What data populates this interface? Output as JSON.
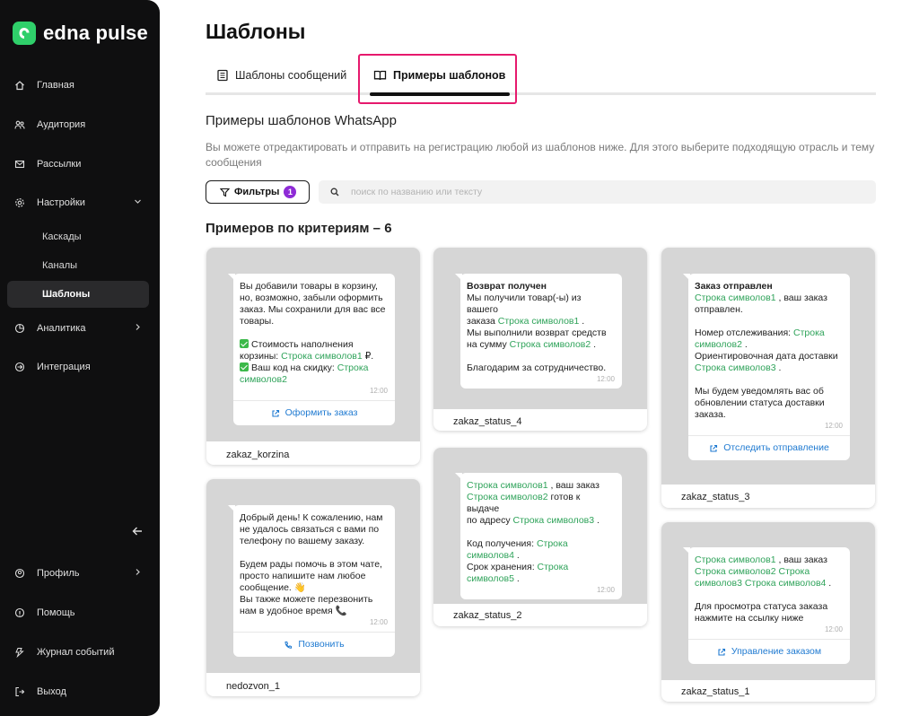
{
  "logo": {
    "text": "edna pulse",
    "color": "#2fcf6a"
  },
  "sidebar": {
    "nav": [
      {
        "label": "Главная",
        "icon": "home-icon"
      },
      {
        "label": "Аудитория",
        "icon": "audience-icon"
      },
      {
        "label": "Рассылки",
        "icon": "mail-icon"
      },
      {
        "label": "Настройки",
        "icon": "gear-icon"
      }
    ],
    "settings_sub": [
      {
        "label": "Каскады"
      },
      {
        "label": "Каналы"
      },
      {
        "label": "Шаблоны"
      }
    ],
    "nav2": [
      {
        "label": "Аналитика",
        "icon": "chart-icon"
      },
      {
        "label": "Интеграция",
        "icon": "integration-icon"
      }
    ],
    "bottom": [
      {
        "label": "Профиль",
        "icon": "profile-icon"
      },
      {
        "label": "Помощь",
        "icon": "help-icon"
      },
      {
        "label": "Журнал событий",
        "icon": "log-icon"
      },
      {
        "label": "Выход",
        "icon": "logout-icon"
      }
    ]
  },
  "page": {
    "title": "Шаблоны",
    "tabs": [
      {
        "label": "Шаблоны сообщений"
      },
      {
        "label": "Примеры шаблонов"
      }
    ],
    "section_title": "Примеры шаблонов WhatsApp",
    "section_desc": "Вы можете отредактировать и отправить на регистрацию любой из шаблонов ниже. Для этого выберите подходящую отрасль и тему сообщения",
    "filters_label": "Фильтры",
    "filters_count": "1",
    "search_placeholder": "поиск по названию или тексту",
    "count_title": "Примеров по критериям – 6",
    "accent_color": "#e6196d"
  },
  "cards": {
    "zakaz_korzina": {
      "l1": "Вы добавили товары в корзину,",
      "l2": "но, возможно, забыли оформить",
      "l3": "заказ. Мы сохранили для вас все",
      "l4": "товары.",
      "l5": "Стоимость наполнения",
      "l6a": "корзины: ",
      "l6v": "Строка символов1",
      "l6b": " ₽.",
      "l7a": "Ваш код на скидку: ",
      "l7v": "Строка",
      "l8v": "символов2",
      "time": "12:00",
      "button": "Оформить заказ",
      "caption": "zakaz_korzina"
    },
    "zakaz_status_4": {
      "title": "Возврат получен",
      "l1": "Мы получили товар(-ы) из вашего",
      "l2a": "заказа ",
      "l2v": "Строка символов1",
      "l2b": " .",
      "l3": "Мы выполнили возврат средств",
      "l4a": "на сумму ",
      "l4v": "Строка символов2",
      "l4b": " .",
      "l5": "Благодарим за сотрудничество.",
      "time": "12:00",
      "caption": "zakaz_status_4"
    },
    "zakaz_status_3": {
      "title": "Заказ отправлен",
      "l1v": "Строка символов1",
      "l1b": " , ваш заказ",
      "l2": "отправлен.",
      "l3a": "Номер отслеживания: ",
      "l3v": "Строка",
      "l4v": "символов2",
      "l4b": " .",
      "l5": "Ориентировочная дата доставки",
      "l6v": "Строка символов3",
      "l6b": " .",
      "l7": "Мы будем уведомлять вас об",
      "l8": "обновлении статуса доставки",
      "l9": "заказа.",
      "time": "12:00",
      "button": "Отследить отправление",
      "caption": "zakaz_status_3"
    },
    "nedozvon_1": {
      "l1": "Добрый день! К сожалению, нам",
      "l2": "не удалось связаться с вами по",
      "l3": "телефону по вашему заказу.",
      "l4": "Будем рады помочь в этом чате,",
      "l5": "просто напишите нам любое",
      "l6": "сообщение. 👋",
      "l7": "Вы также можете перезвонить",
      "l8": "нам в удобное время 📞",
      "time": "12:00",
      "button": "Позвонить",
      "caption": "nedozvon_1"
    },
    "zakaz_status_2": {
      "l1v": "Строка символов1",
      "l1b": " , ваш заказ",
      "l2v": "Строка символов2",
      "l2b": "  готов к выдаче",
      "l3a": "по адресу ",
      "l3v": "Строка символов3",
      "l3b": " .",
      "l4a": "Код получения: ",
      "l4v": "Строка",
      "l5v": "символов4",
      "l5b": " .",
      "l6a": "Срок хранения: ",
      "l6v": "Строка",
      "l7v": "символов5",
      "l7b": " .",
      "time": "12:00",
      "caption": "zakaz_status_2"
    },
    "zakaz_status_1": {
      "l1v": "Строка символов1",
      "l1b": " , ваш заказ",
      "l2v": "Строка символов2",
      "l2b": "  ",
      "l2v2": "Строка",
      "l3v": "символов3",
      "l3b": "  ",
      "l3v2": "Строка символов4",
      "l3c": " .",
      "l4": "Для просмотра статуса заказа",
      "l5": "нажмите на ссылку ниже",
      "time": "12:00",
      "button": "Управление заказом",
      "caption": "zakaz_status_1"
    }
  }
}
